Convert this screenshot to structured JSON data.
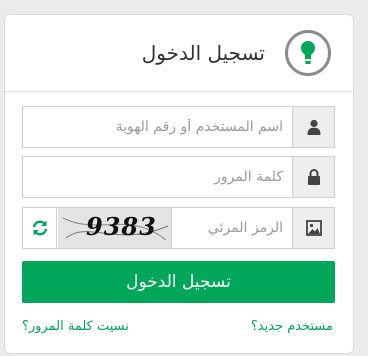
{
  "header": {
    "title": "تسجيل الدخول",
    "logo_icon": "keyhole-icon",
    "logo_color": "#00a65a"
  },
  "form": {
    "username": {
      "placeholder": "اسم المستخدم أو رقم الهوية",
      "value": "",
      "icon": "user-icon"
    },
    "password": {
      "placeholder": "كلمة المرور",
      "value": "",
      "icon": "lock-icon"
    },
    "captcha": {
      "placeholder": "الرمز المرئي",
      "value": "",
      "icon": "image-icon",
      "image_text": "9383",
      "refresh_icon": "refresh-icon"
    },
    "submit_label": "تسجيل الدخول"
  },
  "links": {
    "new_user": "مستخدم جديد؟",
    "forgot_password": "نسيت كلمة المرور؟"
  },
  "colors": {
    "accent": "#00a65a",
    "background": "#ebebeb",
    "addon_bg": "#eeeeee"
  }
}
